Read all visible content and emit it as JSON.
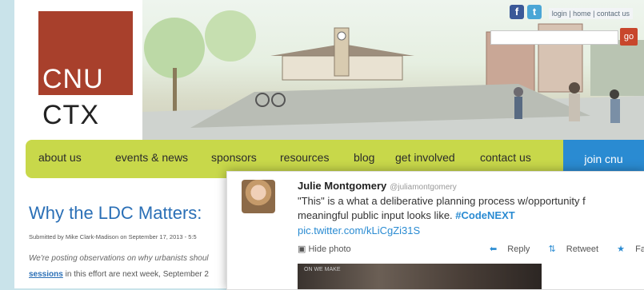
{
  "logo": {
    "line1": "CNU",
    "line2": "CTX"
  },
  "utility": {
    "links": "login | home | contact us"
  },
  "social": {
    "facebook": "f",
    "twitter": "t"
  },
  "search": {
    "value": "",
    "go_label": "go"
  },
  "nav": {
    "items": [
      "about us",
      "events & news",
      "sponsors",
      "resources",
      "blog",
      "get involved",
      "contact us"
    ],
    "join_label": "join cnu"
  },
  "article": {
    "title": "Why the LDC Matters:",
    "byline": "Submitted by Mike Clark-Madison on September 17, 2013 - 5:5",
    "intro": "We're posting observations on why urbanists shoul",
    "line2_bold": "sessions",
    "line2_rest": " in this effort are next week, September 2"
  },
  "tweet": {
    "name": "Julie Montgomery",
    "handle": "@juliamontgomery",
    "text_line1": "\"This\" is a what a deliberative planning process w/opportunity f",
    "text_line2_pre": "meaningful public input looks like. ",
    "hashtag": "#CodeNEXT",
    "link": "pic.twitter.com/kLiCgZi31S",
    "hide_photo": "Hide photo",
    "reply": "Reply",
    "retweet": "Retweet",
    "favorite": "Favorite",
    "photo_text": "ON WE MAKE"
  }
}
